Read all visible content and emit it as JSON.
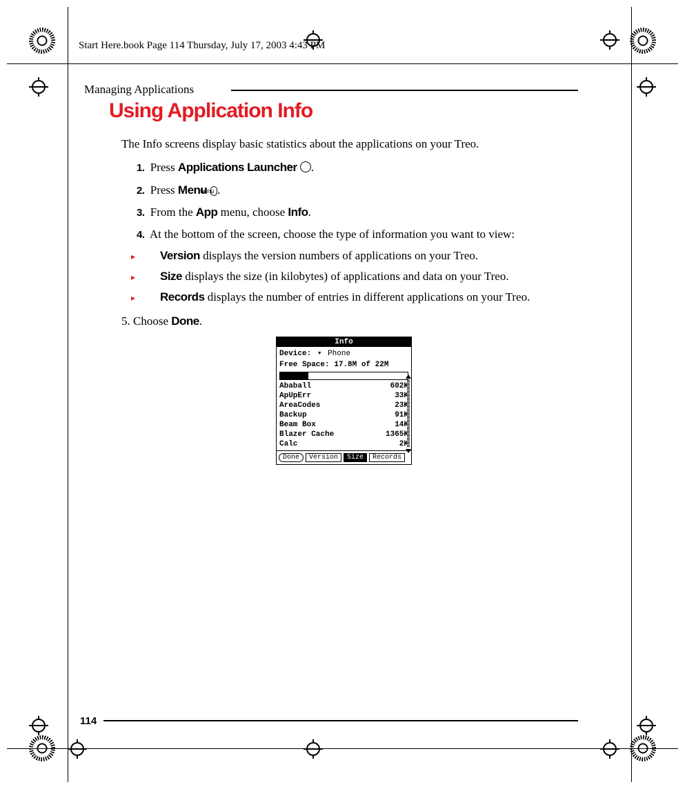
{
  "header": "Start Here.book  Page 114  Thursday, July 17, 2003  4:43 PM",
  "section_label": "Managing Applications",
  "heading": "Using Application Info",
  "intro": "The Info screens display basic statistics about the applications on your Treo.",
  "steps": {
    "s1_pre": "Press ",
    "s1_bold": "Applications Launcher",
    "s2_pre": "Press ",
    "s2_bold": "Menu",
    "s2_icon": "menu",
    "s3_pre": "From the ",
    "s3_bold1": "App",
    "s3_mid": " menu, choose ",
    "s3_bold2": "Info",
    "s4": "At the bottom of the screen, choose the type of information you want to view:"
  },
  "bullets": {
    "b1_bold": "Version",
    "b1_rest": " displays the version numbers of applications on your Treo.",
    "b2_bold": "Size",
    "b2_rest": " displays the size (in kilobytes) of applications and data on your Treo.",
    "b3_bold": "Records",
    "b3_rest": " displays the number of entries in different applications on your Treo."
  },
  "step5_pre": "5. Choose ",
  "step5_bold": "Done",
  "palm": {
    "title": "Info",
    "device_label": "Device:",
    "device_value": "Phone",
    "free_space": "Free Space: 17.8M of 22M",
    "rows": [
      {
        "name": "Ababall",
        "size": "602K"
      },
      {
        "name": "ApUpErr",
        "size": "33K"
      },
      {
        "name": "AreaCodes",
        "size": "23K"
      },
      {
        "name": "Backup",
        "size": "91K"
      },
      {
        "name": "Beam Box",
        "size": "14K"
      },
      {
        "name": "Blazer Cache",
        "size": "1365K"
      },
      {
        "name": "Calc",
        "size": "2K"
      }
    ],
    "done": "Done",
    "tab_version": "Version",
    "tab_size": "Size",
    "tab_records": "Records"
  },
  "page_number": "114"
}
